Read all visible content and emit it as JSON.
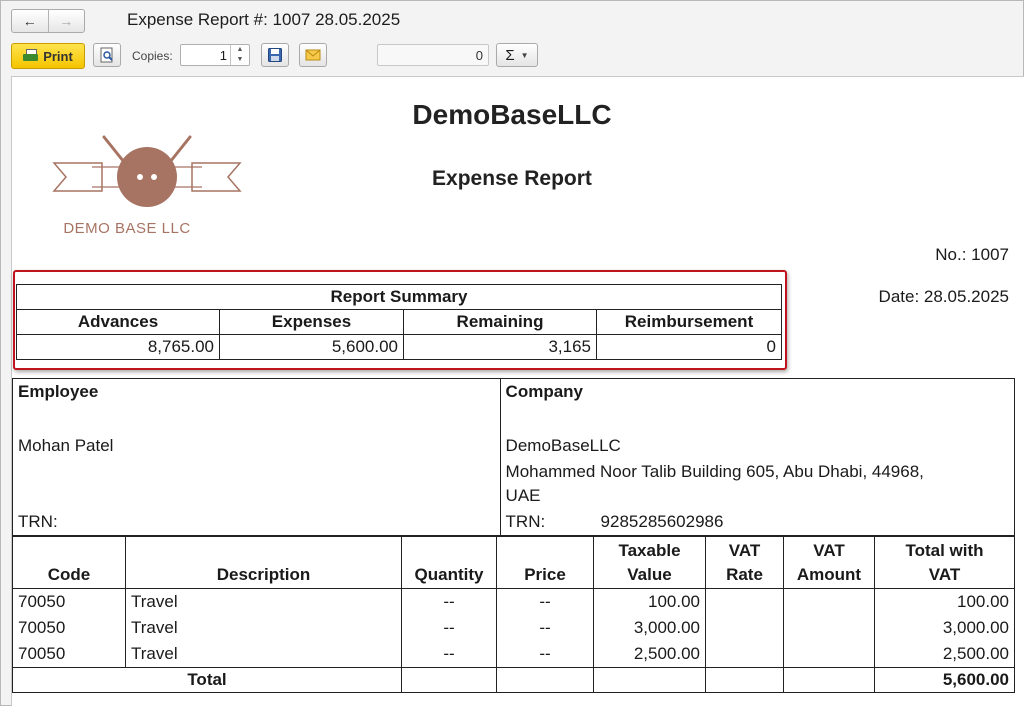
{
  "window": {
    "title": "Expense Report #: 1007 28.05.2025",
    "back_icon": "arrow-left-icon",
    "forward_icon": "arrow-right-icon"
  },
  "toolbar": {
    "print_label": "Print",
    "copies_label": "Copies:",
    "copies_value": "1",
    "number_field_value": "0",
    "sum_symbol": "Σ",
    "print_color": "#f4c400"
  },
  "document": {
    "company_name": "DemoBaseLLC",
    "report_title": "Expense Report",
    "logo_text": "DEMO BASE LLC",
    "number_text": "No.: 1007",
    "date_text": "Date: 28.05.2025",
    "summary": {
      "title": "Report Summary",
      "headers": [
        "Advances",
        "Expenses",
        "Remaining",
        "Reimbursement"
      ],
      "values": [
        "8,765.00",
        "5,600.00",
        "3,165",
        "0"
      ]
    },
    "employee": {
      "heading": "Employee",
      "name": "Mohan Patel",
      "trn_label": "TRN:"
    },
    "company": {
      "heading": "Company",
      "name": "DemoBaseLLC",
      "address_line1": "Mohammed Noor Talib Building 605, Abu Dhabi, 44968,",
      "address_line2": "UAE",
      "trn_label": "TRN:",
      "trn_value": "9285285602986"
    },
    "items": {
      "headers": {
        "code": "Code",
        "description": "Description",
        "quantity": "Quantity",
        "price": "Price",
        "taxable_1": "Taxable",
        "taxable_2": "Value",
        "vat_rate_1": "VAT",
        "vat_rate_2": "Rate",
        "vat_amount_1": "VAT",
        "vat_amount_2": "Amount",
        "total_1": "Total with",
        "total_2": "VAT"
      },
      "rows": [
        {
          "code": "70050",
          "description": "Travel",
          "quantity": "--",
          "price": "--",
          "taxable": "100.00",
          "vat_rate": "",
          "vat_amount": "",
          "total": "100.00"
        },
        {
          "code": "70050",
          "description": "Travel",
          "quantity": "--",
          "price": "--",
          "taxable": "3,000.00",
          "vat_rate": "",
          "vat_amount": "",
          "total": "3,000.00"
        },
        {
          "code": "70050",
          "description": "Travel",
          "quantity": "--",
          "price": "--",
          "taxable": "2,500.00",
          "vat_rate": "",
          "vat_amount": "",
          "total": "2,500.00"
        }
      ],
      "total_label": "Total",
      "total_value": "5,600.00"
    },
    "highlight_color": "#c0141c",
    "logo_color": "#a77463"
  }
}
